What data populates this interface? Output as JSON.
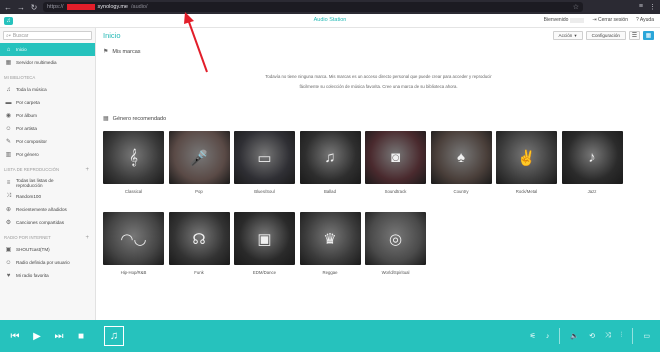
{
  "browser": {
    "url_prefix": "https://",
    "url_host": "synology.me",
    "url_path": "/audio/",
    "back_glyph": "←",
    "forward_glyph": "→",
    "reload_glyph": "↻",
    "star_glyph": "☆",
    "right_glyphs": [
      "≡",
      "⋮"
    ]
  },
  "header": {
    "logo_glyph": "♫",
    "title": "Audio Station",
    "welcome": "Bienvenido",
    "logout": "Cerrar sesión",
    "help": "Ayuda",
    "logout_glyph": "⇥",
    "help_glyph": "?"
  },
  "sidebar": {
    "search_placeholder": "Buscar",
    "search_glyph": "⌕▾",
    "library_heading": "MI BIBLIOTECA",
    "playlist_heading": "LISTA DE REPRODUCCIÓN",
    "radio_heading": "RADIO POR INTERNET",
    "plus_glyph": "+",
    "top_items": [
      {
        "label": "Inicio",
        "icon": "⌂",
        "active": true
      },
      {
        "label": "Servidor multimedia",
        "icon": "▦",
        "active": false
      }
    ],
    "library_items": [
      {
        "label": "Toda la música",
        "icon": "♫"
      },
      {
        "label": "Por carpeta",
        "icon": "▬"
      },
      {
        "label": "Por álbum",
        "icon": "◉"
      },
      {
        "label": "Por artista",
        "icon": "☺"
      },
      {
        "label": "Por compositor",
        "icon": "✎"
      },
      {
        "label": "Por género",
        "icon": "▥"
      }
    ],
    "playlist_items": [
      {
        "label": "Todas las listas de reproducción",
        "icon": "≡"
      },
      {
        "label": "Random100",
        "icon": "⤨"
      },
      {
        "label": "Recientemente añadidos",
        "icon": "⊕"
      },
      {
        "label": "Canciones compartidas",
        "icon": "⚙"
      }
    ],
    "radio_items": [
      {
        "label": "SHOUTcast(TM)",
        "icon": "▣"
      },
      {
        "label": "Radio definida por usuario",
        "icon": "☺"
      },
      {
        "label": "Mi radio favorita",
        "icon": "♥"
      }
    ]
  },
  "toolbar": {
    "action_label": "Acción",
    "action_caret": "▾",
    "config_label": "Configuración",
    "list_glyph": "☰",
    "grid_glyph": "▦"
  },
  "main": {
    "page_title": "Inicio",
    "my_marks_heading": "Mis marcas",
    "my_marks_glyph": "⚑",
    "empty_line1": "Todavía no tiene ninguna marca. Mis marcas es un acceso directo personal que puede crear para acceder y reproducir",
    "empty_line2": "fácilmente su colección de música favorita. Cree una marca de su biblioteca ahora.",
    "genre_heading": "Género recomendado",
    "genre_glyph": "▦",
    "genres": [
      {
        "label": "Classical",
        "glyph": "𝄞",
        "color": "#3a3a3a"
      },
      {
        "label": "Pop",
        "glyph": "🎤",
        "color": "#5a4a46"
      },
      {
        "label": "Blues/Soul",
        "glyph": "▭",
        "color": "#2f2f34"
      },
      {
        "label": "Ballad",
        "glyph": "♫",
        "color": "#2e2e2e"
      },
      {
        "label": "Soundtrack",
        "glyph": "◙",
        "color": "#4a2a2e"
      },
      {
        "label": "Country",
        "glyph": "♠",
        "color": "#4a3f3a"
      },
      {
        "label": "Rock/Metal",
        "glyph": "✌",
        "color": "#3d3d3d"
      },
      {
        "label": "Jazz",
        "glyph": "♪",
        "color": "#2b2b2b"
      },
      {
        "label": "Hip-Hop/R&B",
        "glyph": "◠◡",
        "color": "#444444"
      },
      {
        "label": "Funk",
        "glyph": "☊",
        "color": "#333333"
      },
      {
        "label": "EDM/Dance",
        "glyph": "▣",
        "color": "#2a2a2a"
      },
      {
        "label": "Reggae",
        "glyph": "♛",
        "color": "#3b3b3b"
      },
      {
        "label": "World/Spiritual",
        "glyph": "◎",
        "color": "#4a4a4a"
      }
    ]
  },
  "player": {
    "prev_glyph": "⏮",
    "play_glyph": "▶",
    "next_glyph": "⏭",
    "stop_glyph": "■",
    "thumb_glyph": "♫",
    "right_glyphs": [
      "⚟",
      "♪",
      "🔈",
      "⟲",
      "⤨",
      "⫶",
      "▭"
    ]
  },
  "colors": {
    "accent": "#26c2bd",
    "annotation": "#e21e2a"
  }
}
